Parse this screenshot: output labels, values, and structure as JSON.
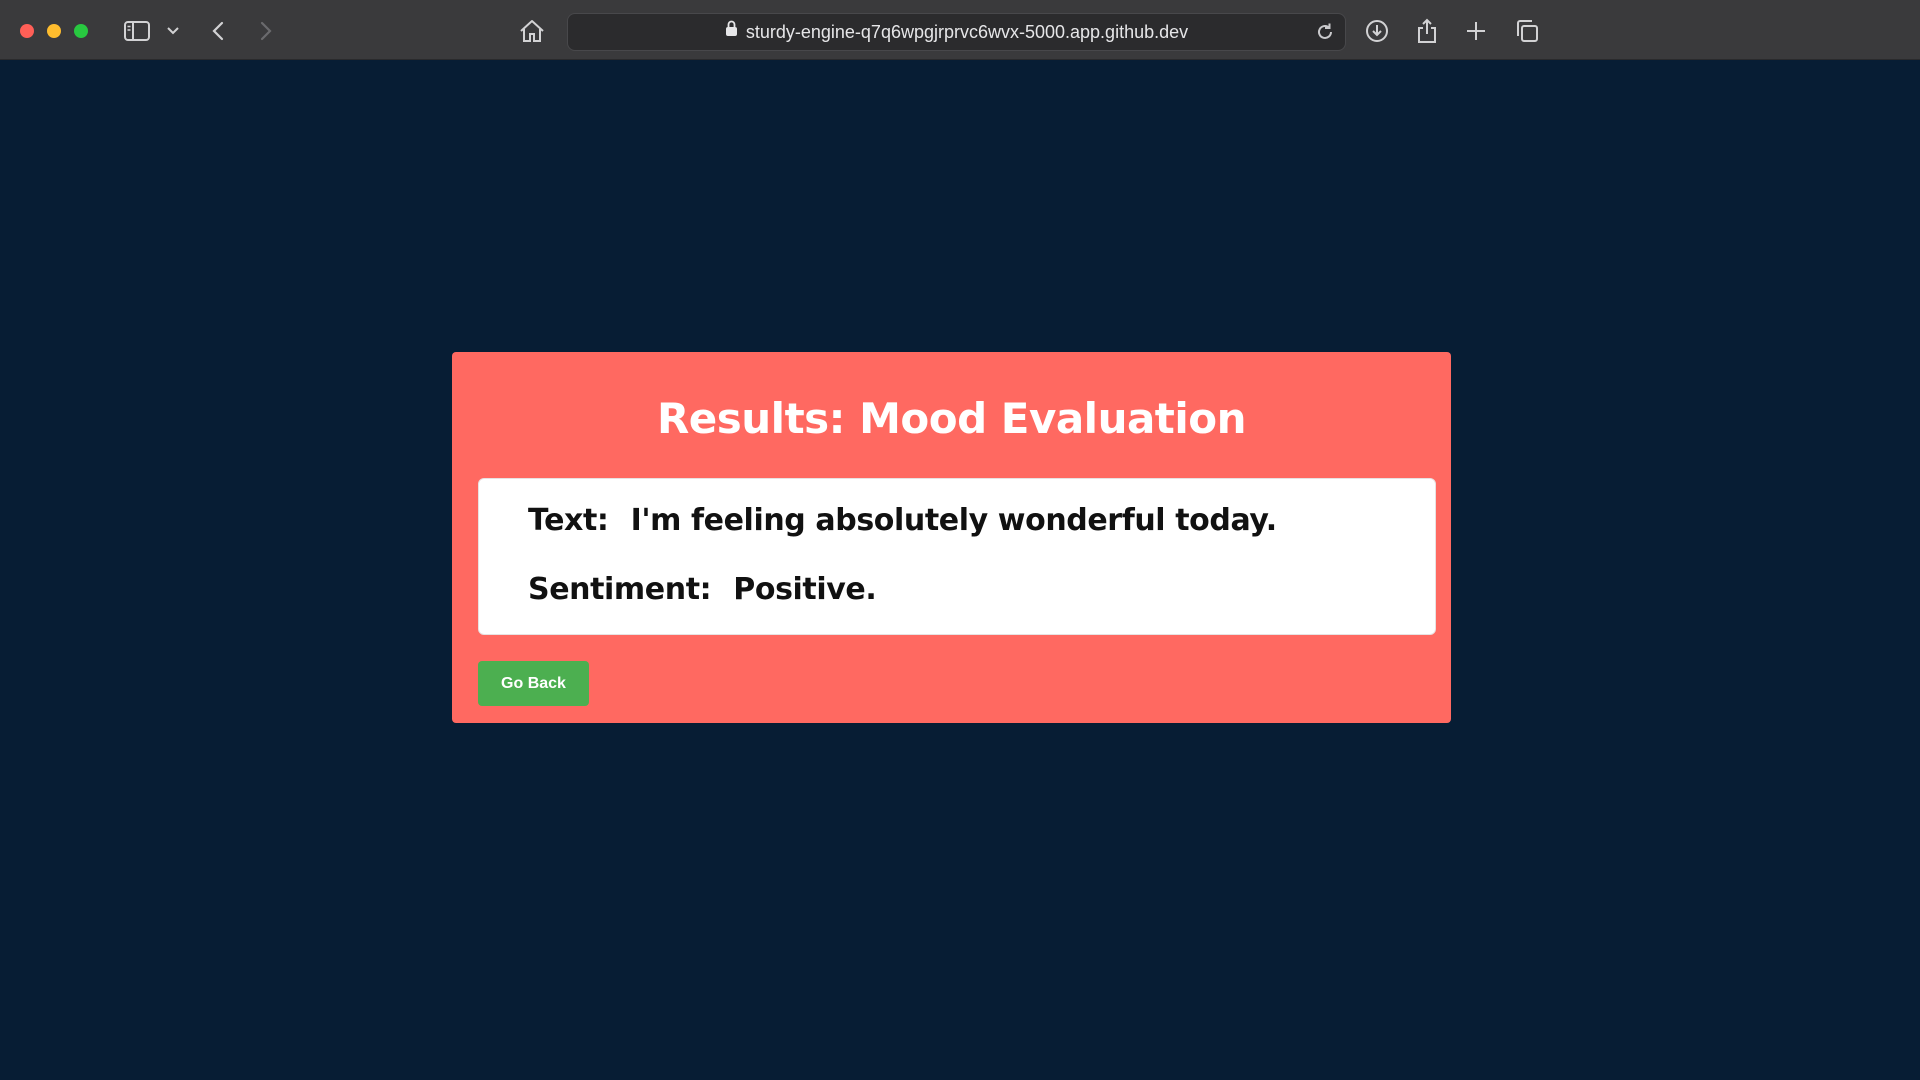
{
  "browser": {
    "url": "sturdy-engine-q7q6wpgjrprvc6wvx-5000.app.github.dev",
    "icons": [
      "sidebar-icon",
      "chevron-down-icon",
      "back-icon",
      "forward-icon",
      "home-icon",
      "lock-icon",
      "reload-icon",
      "download-icon",
      "share-icon",
      "new-tab-icon",
      "tabs-overview-icon"
    ]
  },
  "page": {
    "title": "Results: Mood Evaluation",
    "result": {
      "text_label": "Text:",
      "text_value": "I'm feeling absolutely wonderful today.",
      "sentiment_label": "Sentiment:",
      "sentiment_value": "Positive."
    },
    "back_button_label": "Go Back"
  },
  "colors": {
    "page_background": "#071d34",
    "card_background": "#ff6961",
    "result_box_background": "#ffffff",
    "button_background": "#4caf50"
  }
}
